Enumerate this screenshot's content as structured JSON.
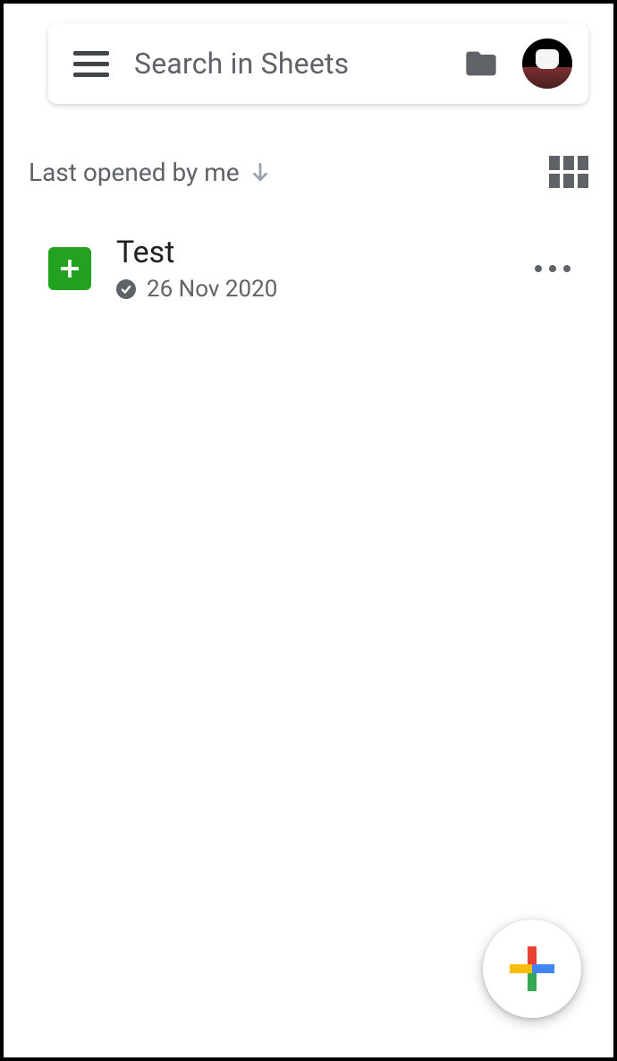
{
  "search": {
    "placeholder": "Search in Sheets"
  },
  "sort": {
    "label": "Last opened by me"
  },
  "files": [
    {
      "title": "Test",
      "date": "26 Nov 2020"
    }
  ]
}
